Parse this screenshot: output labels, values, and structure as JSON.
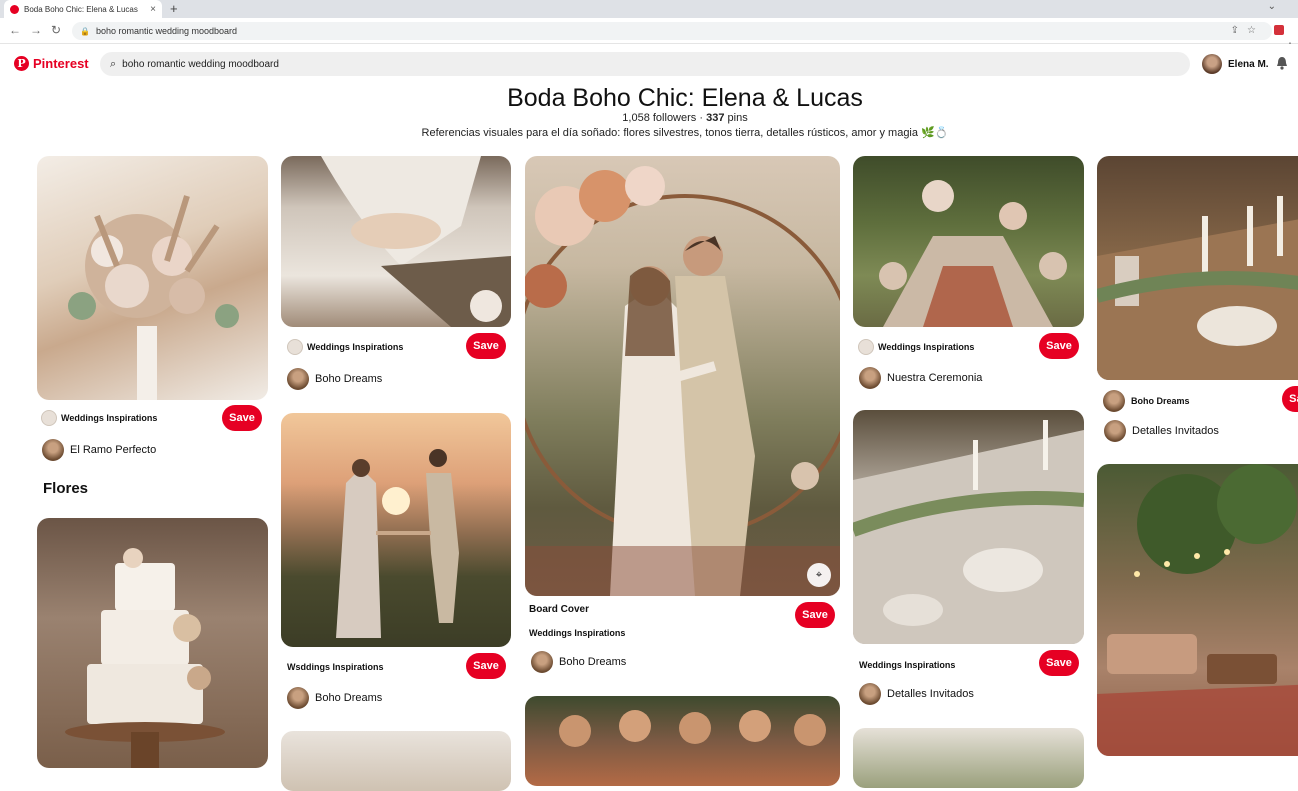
{
  "browser": {
    "tab_title": "Boda Boho Chic: Elena & Lucas",
    "tab_close": "×",
    "new_tab": "+",
    "back": "←",
    "forward": "→",
    "reload": "↻",
    "url": "boho romantic wedding moodboard",
    "chevron": "⌄"
  },
  "header": {
    "logo_text": "Pinterest",
    "search_value": "boho romantic wedding moodboard",
    "user_name": "Elena M."
  },
  "board": {
    "title": "Boda Boho Chic: Elena & Lucas",
    "followers": "1,058 followers",
    "separator": "·",
    "pins_count": "337",
    "pins_label": "pins",
    "description": "Referencias visuales para el día soñado: flores silvestres, tonos tierra, detalles rústicos, amor y magia 🌿💍"
  },
  "save_label": "Save",
  "pins": [
    {
      "source": "Weddings Inspirations",
      "owner": "El Ramo Perfecto"
    },
    {
      "source": "Weddings Inspirations",
      "owner": "Boho Dreams"
    },
    {
      "source": "Wsddings Inspirations",
      "owner": "Boho Dreams"
    },
    {
      "cover_label": "Board Cover",
      "source": "Weddings Inspirations",
      "owner": "Boho Dreams"
    },
    {
      "source": "Weddings Inspirations",
      "owner": "Nuestra Ceremonia"
    },
    {
      "source": "Weddings Inspirations",
      "owner": "Detalles Invitados"
    },
    {
      "source": "Boho Dreams",
      "owner": "Detalles Invitados"
    }
  ],
  "section_title": "Flores",
  "colors": {
    "brand": "#e60023"
  }
}
